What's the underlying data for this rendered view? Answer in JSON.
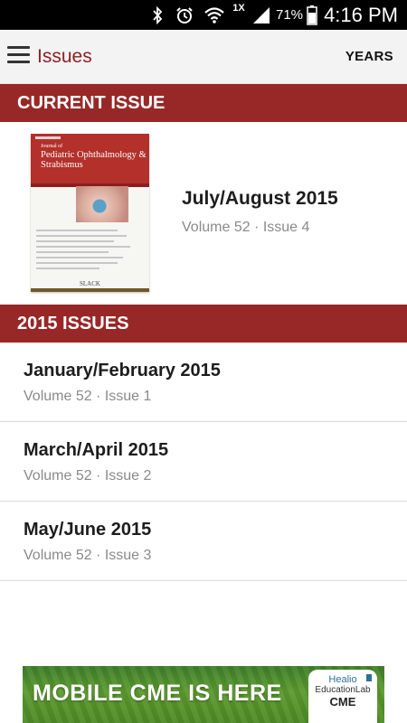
{
  "status_bar": {
    "icons": [
      "bluetooth-icon",
      "alarm-icon",
      "wifi-icon",
      "signal-icon",
      "battery-icon"
    ],
    "network": "1X",
    "battery": "71%",
    "time": "4:16 PM"
  },
  "app_bar": {
    "title": "Issues",
    "years_label": "YEARS",
    "title_color": "#8e1f1f"
  },
  "current_section": {
    "header": "CURRENT ISSUE",
    "cover": {
      "journal_line": "Journal of",
      "journal_title": "Pediatric Ophthalmology & Strabismus",
      "publisher": "SLACK"
    },
    "title": "July/August 2015",
    "subtitle": "Volume 52 · Issue 4"
  },
  "issues_section": {
    "header": "2015 ISSUES",
    "items": [
      {
        "title": "January/February 2015",
        "subtitle": "Volume 52 · Issue 1"
      },
      {
        "title": "March/April 2015",
        "subtitle": "Volume 52 · Issue 2"
      },
      {
        "title": "May/June 2015",
        "subtitle": "Volume 52 · Issue 3"
      }
    ]
  },
  "ad": {
    "text": "MOBILE CME IS HERE",
    "logo_line1": "Healio",
    "logo_line2": "EducationLab",
    "logo_line3": "CME"
  },
  "colors": {
    "section_header_bg": "#972827",
    "ad_green": "#5c9a2f"
  }
}
